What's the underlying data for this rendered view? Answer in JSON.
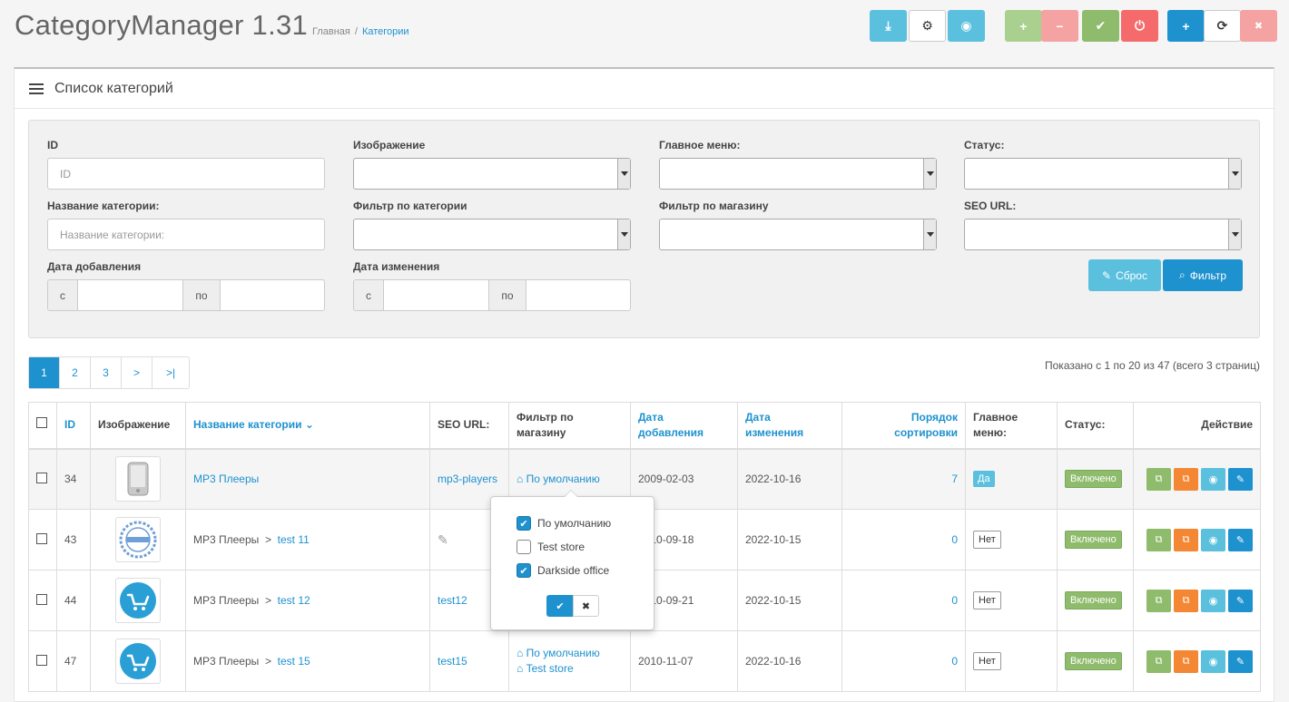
{
  "app": {
    "title": "CategoryManager 1.31"
  },
  "breadcrumb": {
    "home": "Главная",
    "separator": "/",
    "current": "Категории"
  },
  "toolbar": {
    "buttons": [
      {
        "name": "download-icon",
        "glyph": "⤓",
        "color": "#5bc0de"
      },
      {
        "name": "settings-icon",
        "glyph": "⚙",
        "color": "#ffffff"
      },
      {
        "name": "eye-icon",
        "glyph": "◉",
        "color": "#5bc0de"
      },
      {
        "name": "plus-icon",
        "glyph": "+",
        "color": "#a9d08e"
      },
      {
        "name": "minus-icon",
        "glyph": "−",
        "color": "#f4a2a2"
      },
      {
        "name": "check-icon",
        "glyph": "✔",
        "color": "#8fbb6c"
      },
      {
        "name": "power-icon",
        "glyph": "⏻",
        "color": "#f56b6b"
      },
      {
        "name": "add-icon",
        "glyph": "+",
        "color": "#1e91cf"
      },
      {
        "name": "refresh-icon",
        "glyph": "⟳",
        "color": "#ffffff"
      },
      {
        "name": "trash-icon",
        "glyph": "🗑",
        "color": "#f4a2a2"
      }
    ]
  },
  "panel": {
    "title": "Список категорий"
  },
  "filters": {
    "id_label": "ID",
    "id_placeholder": "ID",
    "image_label": "Изображение",
    "main_menu_label": "Главное меню:",
    "status_label": "Статус:",
    "name_label": "Название категории:",
    "name_placeholder": "Название категории:",
    "category_filter_label": "Фильтр по категории",
    "store_filter_label": "Фильтр по магазину",
    "seo_label": "SEO URL:",
    "date_added_label": "Дата добавления",
    "date_modified_label": "Дата изменения",
    "from": "с",
    "to": "по",
    "reset_button": "Сброс",
    "filter_button": "Фильтр"
  },
  "pagination": {
    "pages": [
      "1",
      "2",
      "3",
      ">",
      ">|"
    ],
    "current": "1"
  },
  "results_text": "Показано с 1 по 20 из 47 (всего 3 страниц)",
  "table": {
    "headers": {
      "id": "ID",
      "image": "Изображение",
      "name": "Название категории",
      "seo": "SEO URL:",
      "store_line1": "Фильтр по",
      "store_line2": "магазину",
      "added_line1": "Дата",
      "added_line2": "добавления",
      "modified_line1": "Дата",
      "modified_line2": "изменения",
      "sort_line1": "Порядок",
      "sort_line2": "сортировки",
      "menu_line1": "Главное",
      "menu_line2": "меню:",
      "status": "Статус:",
      "action": "Действие"
    },
    "rows": [
      {
        "id": "34",
        "parent": "",
        "sep": "",
        "name": "MP3 Плееры",
        "seo": "mp3-players",
        "store1": "По умолчанию",
        "store2": "",
        "added": "2009-02-03",
        "modified": "2022-10-16",
        "sort": "7",
        "menu": "Да",
        "status": "Включено"
      },
      {
        "id": "43",
        "parent": "MP3 Плееры",
        "sep": ">",
        "name": "test 11",
        "seo": "",
        "store1": "",
        "store2": "",
        "added": "2010-09-18",
        "modified": "2022-10-15",
        "sort": "0",
        "menu": "Нет",
        "status": "Включено"
      },
      {
        "id": "44",
        "parent": "MP3 Плееры",
        "sep": ">",
        "name": "test 12",
        "seo": "test12",
        "store1": "",
        "store2": "",
        "added": "2010-09-21",
        "modified": "2022-10-15",
        "sort": "0",
        "menu": "Нет",
        "status": "Включено"
      },
      {
        "id": "47",
        "parent": "MP3 Плееры",
        "sep": ">",
        "name": "test 15",
        "seo": "test15",
        "store1": "По умолчанию",
        "store2": "Test store",
        "added": "2010-11-07",
        "modified": "2022-10-16",
        "sort": "0",
        "menu": "Нет",
        "status": "Включено"
      }
    ]
  },
  "popover": {
    "options": [
      {
        "label": "По умолчанию",
        "checked": true
      },
      {
        "label": "Test store",
        "checked": false
      },
      {
        "label": "Darkside office",
        "checked": true
      }
    ]
  }
}
